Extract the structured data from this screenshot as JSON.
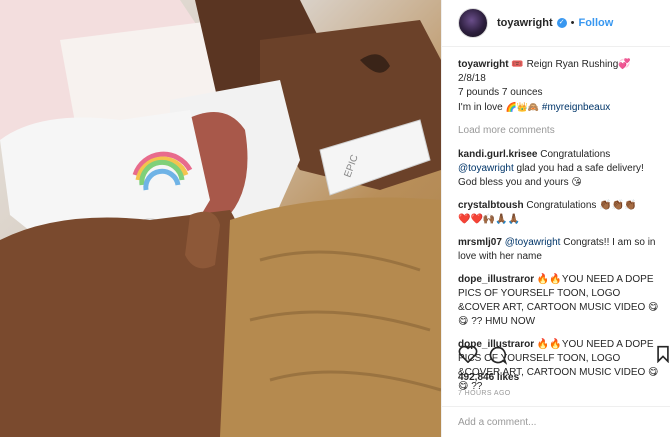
{
  "post": {
    "username": "toyawright",
    "follow_label": "Follow",
    "caption": {
      "user": "toyawright",
      "line1": "🎟️ Reign Ryan Rushing💞",
      "line2": "2/8/18",
      "line3": "7 pounds 7 ounces",
      "line4_text": "I'm in love",
      "line4_emoji": "🌈👑🙈",
      "hashtag": "#myreignbeaux"
    },
    "load_more": "Load more comments",
    "comments": [
      {
        "user": "kandi.gurl.krisee",
        "text_a": "Congratulations",
        "mention": "@toyawright",
        "text_b": "glad you had a safe delivery! God bless you and yours 😘"
      },
      {
        "user": "crystalbtoush",
        "text_a": "Congratulations 👏🏾👏🏾👏🏾",
        "line2": "❤️❤️🙌🏾🙏🏾🙏🏾"
      },
      {
        "user": "mrsmlj07",
        "mention": "@toyawright",
        "text_b": "Congrats!! I am so in love with her name"
      },
      {
        "user": "dope_illustraror",
        "text": "🔥🔥YOU NEED A DOPE PICS OF YOURSELF TOON, LOGO &COVER ART, CARTOON MUSIC VIDEO 😋😋 ?? HMU NOW"
      },
      {
        "user": "dope_illustraror",
        "text": "🔥🔥YOU NEED A DOPE PICS OF YOURSELF TOON, LOGO &COVER ART, CARTOON MUSIC VIDEO 😋😋 ??"
      }
    ],
    "likes": "492,846 likes",
    "time": "7 HOURS AGO",
    "add_comment_placeholder": "Add a comment...",
    "hospital_band_text": "EPIC"
  }
}
